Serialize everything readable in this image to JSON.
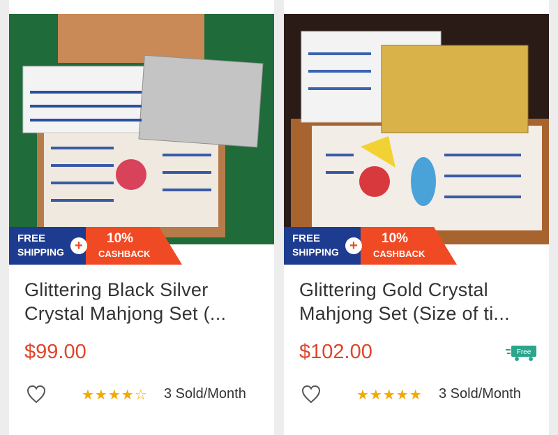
{
  "products": [
    {
      "title": "Glittering Black Silver Crystal Mahjong Set (...",
      "price": "$99.00",
      "rating_stars": "★★★★☆",
      "rating": 4.5,
      "sold": "3 Sold/Month",
      "free_tag": "",
      "tile_color": "#c4c4c4"
    },
    {
      "title": "Glittering Gold Crystal Mahjong Set (Size of ti...",
      "price": "$102.00",
      "rating_stars": "★★★★★",
      "rating": 5,
      "sold": "3 Sold/Month",
      "free_tag": "Free",
      "tile_color": "#d9b24a"
    }
  ],
  "promo": {
    "free_line1": "FREE",
    "free_line2": "SHIPPING",
    "plus": "+",
    "cashback_pct": "10%",
    "cashback_label": "CASHBACK"
  },
  "colors": {
    "price": "#e0452b",
    "star": "#f2a900",
    "free_badge": "#1d3b8f",
    "cashback_badge": "#ef4a24",
    "free_delivery": "#2ca58d"
  },
  "icons": {
    "favorite": "heart-outline-icon",
    "free_delivery": "delivery-truck-icon"
  }
}
